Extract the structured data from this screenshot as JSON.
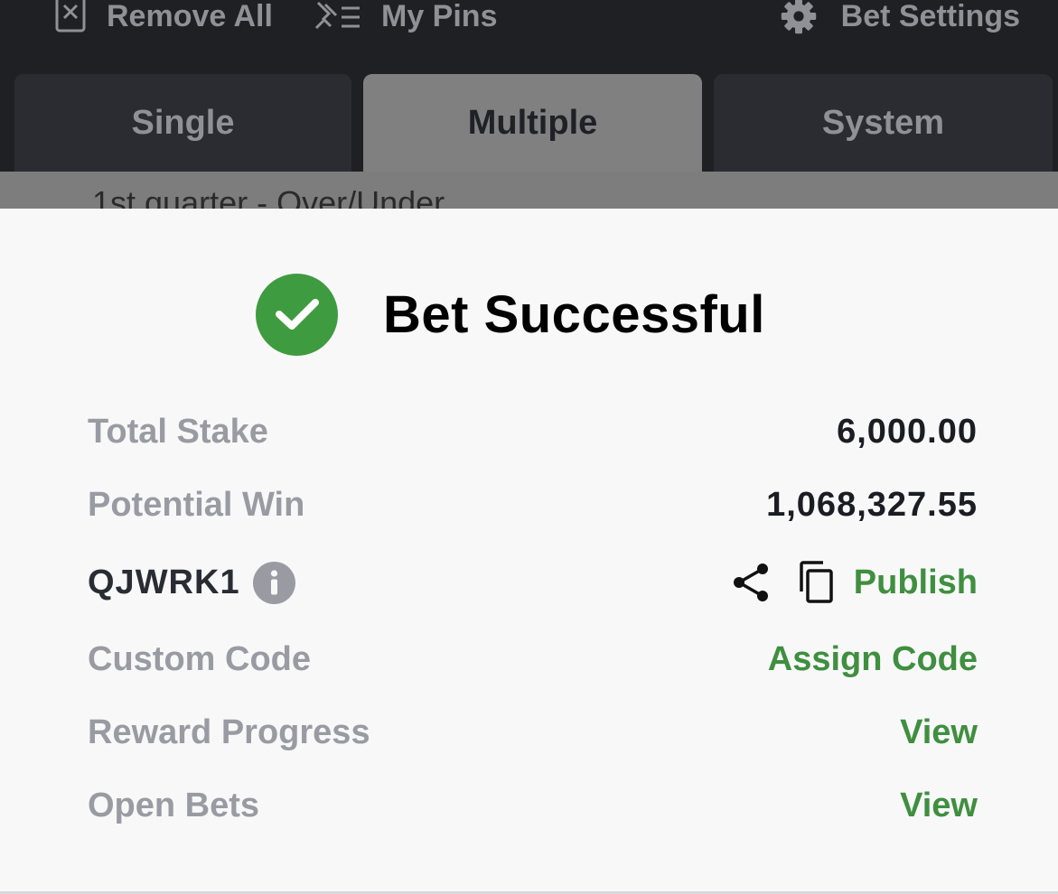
{
  "toolbar": {
    "remove_all": "Remove All",
    "my_pins": "My Pins",
    "bet_settings": "Bet Settings"
  },
  "tabs": [
    {
      "label": "Single",
      "active": false
    },
    {
      "label": "Multiple",
      "active": true
    },
    {
      "label": "System",
      "active": false
    }
  ],
  "background_market": "1st quarter - Over/Under",
  "success": {
    "title": "Bet Successful",
    "icon": "check-circle-icon",
    "accent_color": "#3f9b3f"
  },
  "summary": {
    "total_stake_label": "Total Stake",
    "total_stake_value": "6,000.00",
    "potential_win_label": "Potential Win",
    "potential_win_value": "1,068,327.55",
    "booking_code": "QJWRK1",
    "publish_label": "Publish",
    "custom_code_label": "Custom Code",
    "assign_code_label": "Assign Code",
    "reward_progress_label": "Reward Progress",
    "reward_progress_link": "View",
    "open_bets_label": "Open Bets",
    "open_bets_link": "View"
  }
}
